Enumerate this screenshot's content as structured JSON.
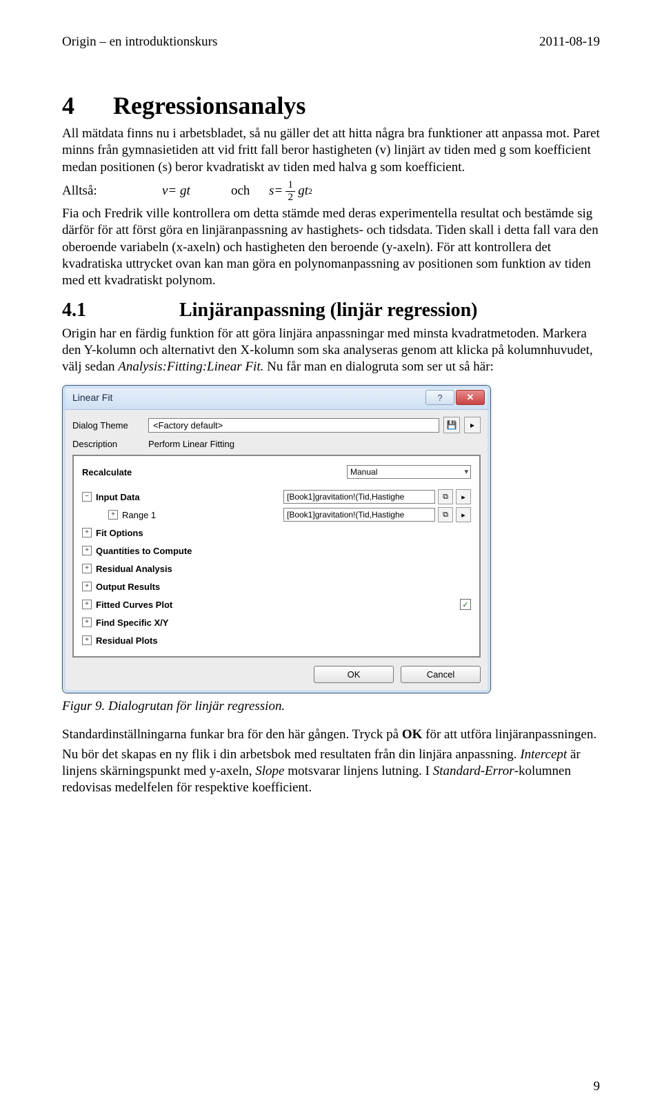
{
  "header": {
    "left": "Origin – en introduktionskurs",
    "right": "2011-08-19"
  },
  "section": {
    "num": "4",
    "title": "Regressionsanalys"
  },
  "para1": "All mätdata finns nu i arbetsbladet, så nu gäller det att hitta några bra funktioner att anpassa mot. Paret minns från gymnasietiden att vid fritt fall beror hastigheten (v) linjärt av tiden med g som koefficient medan positionen (s) beror kvadratiskt av tiden med halva g som koefficient.",
  "formula": {
    "lead": "Alltså:",
    "eq1_lhs": "v=",
    "eq1_rhs": " gt",
    "och": "och",
    "eq2_lhs": "s=",
    "frac_num": "1",
    "frac_den": "2",
    "eq2_rhs": "gt",
    "eq2_sup": "2"
  },
  "para2": "Fia och Fredrik ville kontrollera om detta stämde med deras experimentella resultat och bestämde sig därför för att först göra en linjäranpassning av hastighets- och tidsdata. Tiden skall i detta fall vara den oberoende variabeln (x-axeln) och hastigheten den beroende (y-axeln). För att kontrollera det kvadratiska uttrycket ovan kan man göra en polynomanpassning av positionen som funktion av tiden med ett kvadratiskt polynom.",
  "subsection": {
    "num": "4.1",
    "title": "Linjäranpassning (linjär regression)"
  },
  "para3_a": "Origin har en färdig funktion för att göra linjära anpassningar med minsta kvadratmetoden. Markera den Y-kolumn och alternativt den X-kolumn som ska analyseras genom att klicka på kolumnhuvudet, välj sedan ",
  "para3_b": "Analysis:Fitting:Linear Fit.",
  "para3_c": " Nu får man en dialogruta som ser ut så här:",
  "dialog": {
    "title": "Linear Fit",
    "help_glyph": "?",
    "close_glyph": "✕",
    "theme_label": "Dialog Theme",
    "theme_value": "<Factory default>",
    "save_glyph": "💾",
    "menu_glyph": "▸",
    "desc_label": "Description",
    "desc_value": "Perform Linear Fitting",
    "rows": {
      "recalc_label": "Recalculate",
      "recalc_value": "Manual",
      "input_label": "Input Data",
      "input_value": "[Book1]gravitation!(Tid,Hastighe",
      "range_label": "Range 1",
      "range_value": "[Book1]gravitation!(Tid,Hastighe",
      "fit_label": "Fit Options",
      "qty_label": "Quantities to Compute",
      "resid_label": "Residual Analysis",
      "out_label": "Output Results",
      "fitted_label": "Fitted Curves Plot",
      "fitted_checked": "✓",
      "findxy_label": "Find Specific X/Y",
      "residplot_label": "Residual Plots"
    },
    "ok": "OK",
    "cancel": "Cancel"
  },
  "figure_caption": "Figur 9. Dialogrutan för linjär regression.",
  "para4_a": "Standardinställningarna funkar bra för den här gången. Tryck på ",
  "para4_b": "OK",
  "para4_c": " för att utföra linjäranpassningen.",
  "para5_a": "Nu bör det skapas en ny flik i din arbetsbok med resultaten från din linjära anpassning. ",
  "para5_b": "Intercept",
  "para5_c": " är linjens skärningspunkt med y-axeln, ",
  "para5_d": "Slope",
  "para5_e": " motsvarar linjens lutning. I ",
  "para5_f": "Standard-Error",
  "para5_g": "-kolumnen redovisas medelfelen för respektive koefficient.",
  "page_number": "9"
}
